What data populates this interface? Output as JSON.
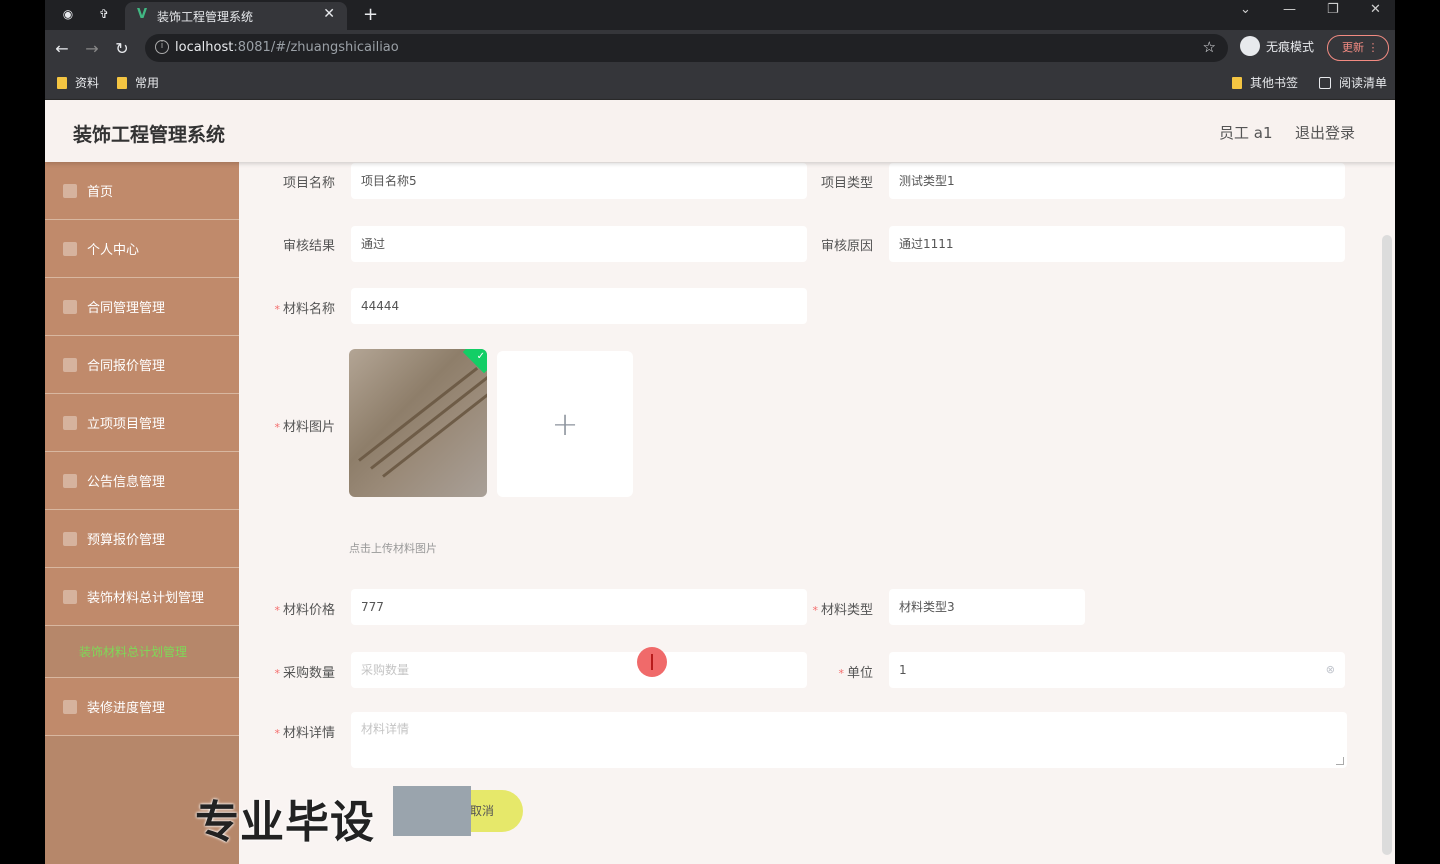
{
  "browser": {
    "tab_title": "装饰工程管理系统",
    "url_host": "localhost",
    "url_path": ":8081/#/zhuangshicailiao",
    "incognito_label": "无痕模式",
    "update_label": "更新",
    "bookmarks": [
      "资料",
      "常用"
    ],
    "bookmarks_right": [
      "其他书签",
      "阅读清单"
    ]
  },
  "header": {
    "title": "装饰工程管理系统",
    "user": "员工 a1",
    "logout": "退出登录"
  },
  "sidebar": {
    "items": [
      {
        "label": "首页"
      },
      {
        "label": "个人中心"
      },
      {
        "label": "合同管理管理"
      },
      {
        "label": "合同报价管理"
      },
      {
        "label": "立项项目管理"
      },
      {
        "label": "公告信息管理"
      },
      {
        "label": "预算报价管理"
      },
      {
        "label": "装饰材料总计划管理"
      }
    ],
    "submenu_label": "装饰材料总计划管理",
    "last_item": "装修进度管理"
  },
  "form": {
    "project_name_label": "项目名称",
    "project_name_value": "项目名称5",
    "project_type_label": "项目类型",
    "project_type_value": "测试类型1",
    "review_result_label": "审核结果",
    "review_result_value": "通过",
    "review_reason_label": "审核原因",
    "review_reason_value": "通过1111",
    "material_name_label": "材料名称",
    "material_name_value": "44444",
    "material_image_label": "材料图片",
    "upload_tip": "点击上传材料图片",
    "upload_plus": "+",
    "material_price_label": "材料价格",
    "material_price_value": "777",
    "material_type_label": "材料类型",
    "material_type_value": "材料类型3",
    "purchase_qty_label": "采购数量",
    "purchase_qty_placeholder": "采购数量",
    "unit_label": "单位",
    "unit_value": "1",
    "material_detail_label": "材料详情",
    "material_detail_placeholder": "材料详情",
    "cancel_label": "取消"
  },
  "overlay": {
    "watermark": "专业毕设"
  },
  "colors": {
    "sidebar_bg": "#c08a6b",
    "submenu_active": "#7ed957",
    "required": "#f56c6c"
  }
}
